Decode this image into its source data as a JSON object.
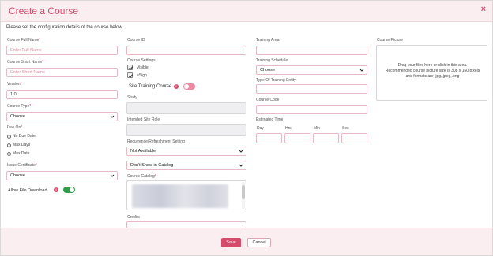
{
  "header": {
    "title": "Create a Course",
    "close_glyph": "×"
  },
  "intro": "Please set the configuration details of the course below",
  "col1": {
    "full_name": {
      "label": "Course Full Name",
      "required": "*",
      "placeholder": "Enter Full Name"
    },
    "short_name": {
      "label": "Course Short Name",
      "required": "*",
      "placeholder": "Enter Short Name"
    },
    "version": {
      "label": "Version",
      "required": "*",
      "value": "1.0"
    },
    "course_type": {
      "label": "Course Type",
      "required": "*",
      "value": "Choose"
    },
    "due_on": {
      "label": "Due On",
      "required": "*",
      "options": [
        "No Due Date",
        "Max Days",
        "Max Date"
      ]
    },
    "issue_certificate": {
      "label": "Issue Certificate",
      "required": "*",
      "value": "Choose"
    },
    "allow_file_download": {
      "label": "Allow File Download",
      "on": true
    }
  },
  "col2": {
    "course_id": {
      "label": "Course ID"
    },
    "course_settings": {
      "label": "Course Settings",
      "options": [
        {
          "label": "Visible",
          "checked": true
        },
        {
          "label": "eSign",
          "checked": true
        }
      ]
    },
    "site_training_course": {
      "label": "Site Training Course",
      "on": false
    },
    "study": {
      "label": "Study"
    },
    "intended_site_role": {
      "label": "Intended Site Role"
    },
    "recurrence": {
      "label": "Recurrence/Refreshment Setting",
      "value": "Not Available"
    },
    "catalog_visibility": {
      "value": "Don't Show in Catalog"
    },
    "course_catalog": {
      "label": "Course Catalog",
      "required": "*"
    },
    "credits": {
      "label": "Credits"
    }
  },
  "col3": {
    "training_area": {
      "label": "Training Area"
    },
    "training_schedule": {
      "label": "Training Schedule",
      "value": "Choose"
    },
    "type_of_training_entity": {
      "label": "Type Of Training Entity"
    },
    "course_code": {
      "label": "Course Code"
    },
    "estimated_time": {
      "label": "Estimated Time",
      "units": [
        "Day",
        "Hrs",
        "Min",
        "Sec"
      ]
    }
  },
  "col4": {
    "course_picture": {
      "label": "Course Picture",
      "hint": "Drag your files here or click in this area. Recommended course picture size is 308 x 160 pixels and formats are .jpg,.jpeg,.png"
    }
  },
  "footer": {
    "save_label": "Save",
    "cancel_label": "Cancel"
  },
  "colors": {
    "accent": "#d64a6b",
    "toggle_on": "#2e9e4a",
    "toggle_off": "#f08aa2",
    "header_bg": "#fbeef1"
  }
}
